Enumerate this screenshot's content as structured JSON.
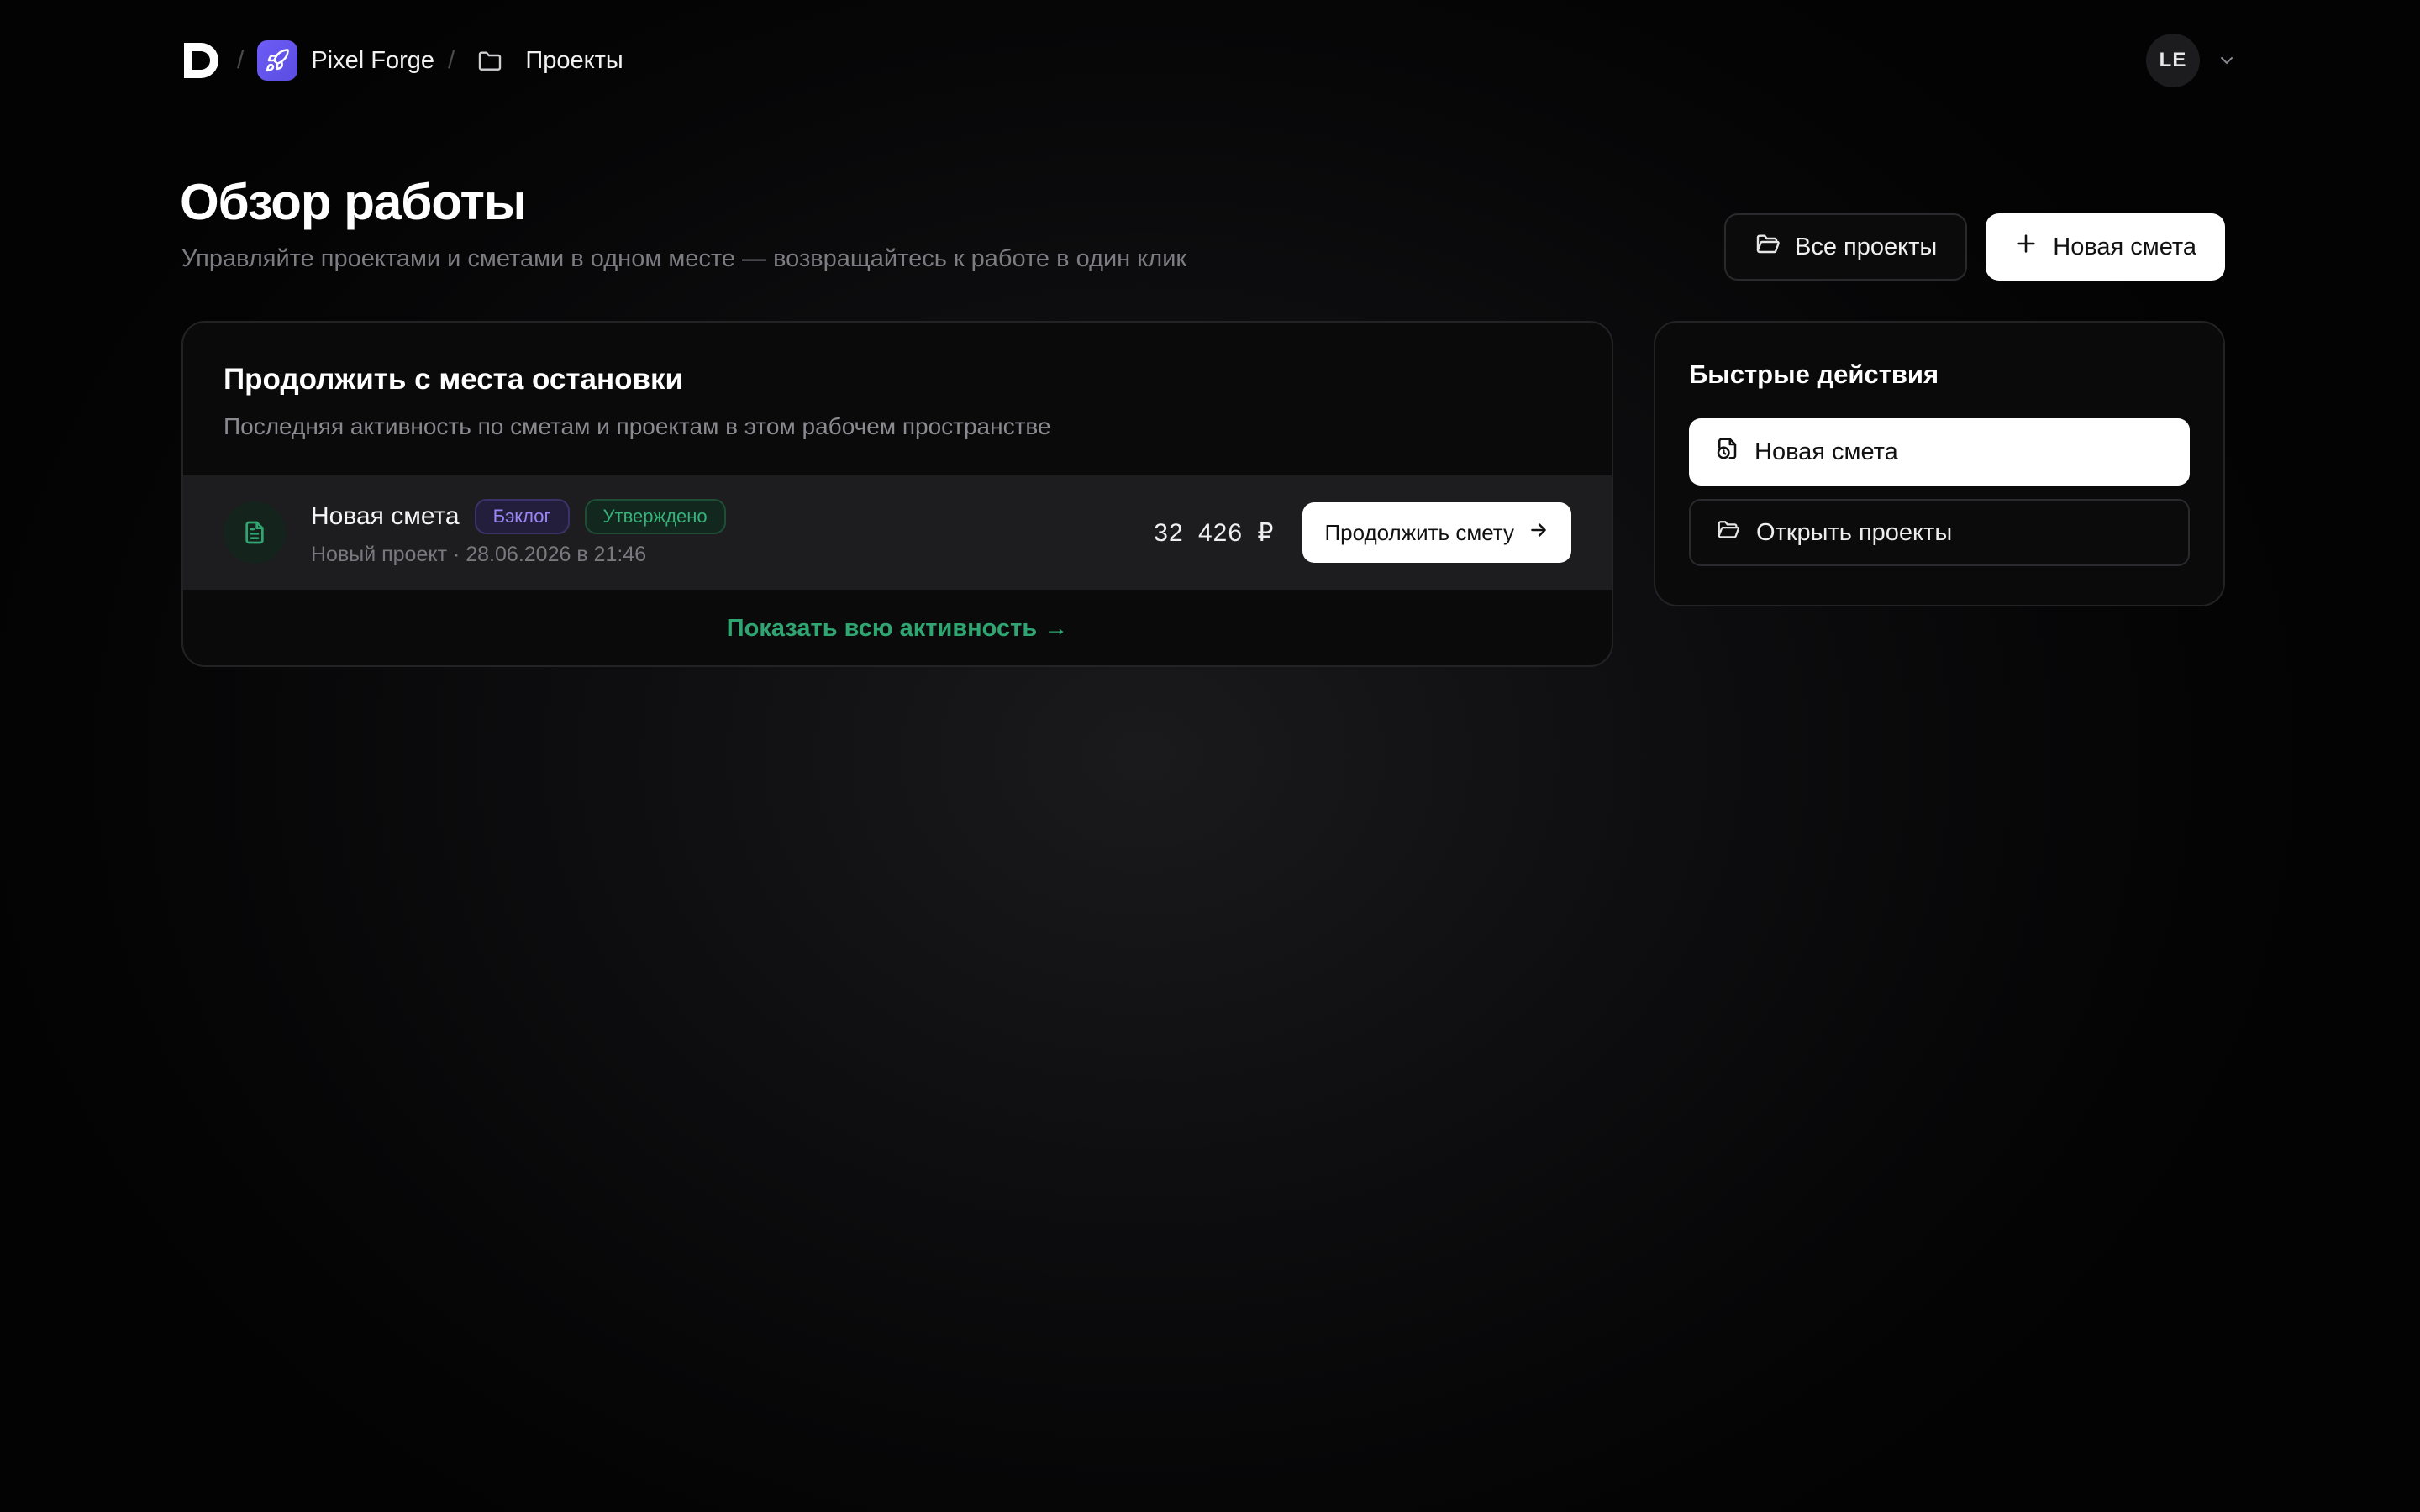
{
  "breadcrumb": {
    "workspace": "Pixel Forge",
    "section": "Проекты",
    "separator": "/"
  },
  "user": {
    "initials": "LE"
  },
  "page": {
    "title": "Обзор работы",
    "subtitle": "Управляйте проектами и сметами в одном месте — возвращайтесь к работе в один клик"
  },
  "header_actions": {
    "all_projects": "Все проекты",
    "new_estimate": "Новая смета"
  },
  "resume": {
    "title": "Продолжить с места остановки",
    "subtitle": "Последняя активность по сметам и проектам в этом рабочем пространстве",
    "items": [
      {
        "name": "Новая смета",
        "badges": [
          "Бэклог",
          "Утверждено"
        ],
        "meta": "Новый проект · 28.06.2026 в 21:46",
        "amount": "32 426 ₽",
        "action": "Продолжить смету"
      }
    ],
    "show_all": "Показать всю активность →"
  },
  "quick_actions": {
    "title": "Быстрые действия",
    "new_estimate": "Новая смета",
    "open_projects": "Открыть проекты"
  },
  "colors": {
    "accent_green": "#2fa571",
    "badge_purple": "#9a86f5",
    "workspace_icon": "#6d5cf6"
  }
}
